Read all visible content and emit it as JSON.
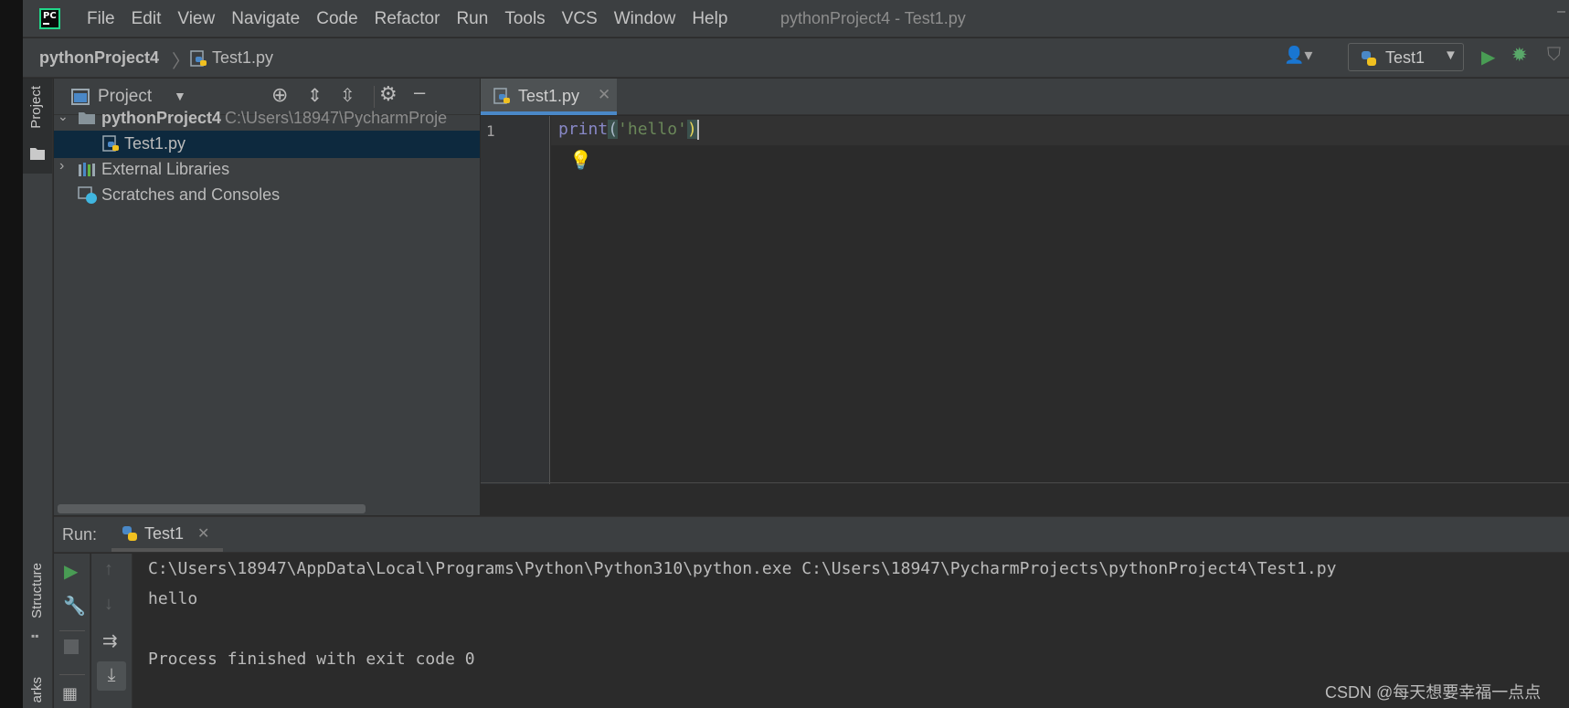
{
  "app": {
    "logo_text": "PC",
    "window_title": "pythonProject4 - Test1.py",
    "minimize_glyph": "–"
  },
  "menu": [
    "File",
    "Edit",
    "View",
    "Navigate",
    "Code",
    "Refactor",
    "Run",
    "Tools",
    "VCS",
    "Window",
    "Help"
  ],
  "breadcrumb": {
    "project": "pythonProject4",
    "file": "Test1.py"
  },
  "run_config": {
    "label": "Test1"
  },
  "side_tabs": {
    "project": "Project",
    "structure": "Structure",
    "bookmarks": "arks"
  },
  "project_panel": {
    "title": "Project",
    "tree": [
      {
        "label": "pythonProject4",
        "path": "C:\\Users\\18947\\PycharmProje",
        "expanded": true
      },
      {
        "label": "Test1.py",
        "selected": true
      },
      {
        "label": "External Libraries"
      },
      {
        "label": "Scratches and Consoles"
      }
    ]
  },
  "editor": {
    "tab_label": "Test1.py",
    "line_number": "1",
    "code": {
      "fn": "print",
      "open": "(",
      "str": "'hello'",
      "close": ")"
    }
  },
  "run_panel": {
    "label": "Run:",
    "tab_label": "Test1",
    "output": [
      "C:\\Users\\18947\\AppData\\Local\\Programs\\Python\\Python310\\python.exe C:\\Users\\18947\\PycharmProjects\\pythonProject4\\Test1.py",
      "hello",
      "",
      "Process finished with exit code 0"
    ]
  },
  "watermark": "CSDN @每天想要幸福一点点",
  "colors": {
    "accent": "#4a88c7",
    "run_green": "#499c54",
    "keyword": "#8888c6",
    "string": "#6a8759",
    "selection": "#0d293e"
  }
}
